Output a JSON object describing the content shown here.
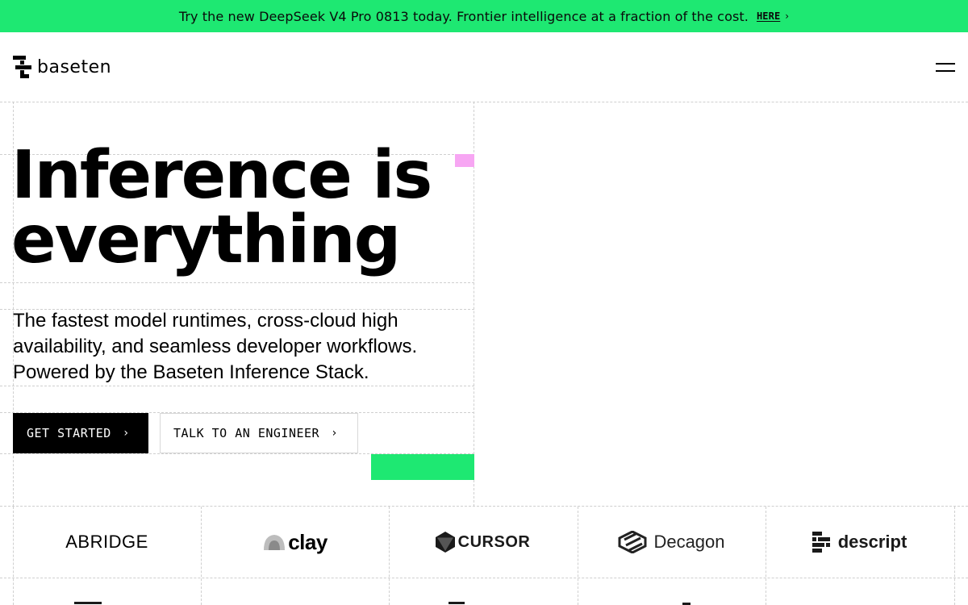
{
  "banner": {
    "text": "Try the new DeepSeek V4 Pro 0813 today. Frontier intelligence at a fraction of the cost.",
    "link_label": "HERE",
    "color": "#1ee872"
  },
  "header": {
    "brand": "baseten",
    "menu_icon": "hamburger-icon"
  },
  "hero": {
    "title_line1": "Inference is",
    "title_line2": "everything",
    "subtitle": "The fastest model runtimes, cross-cloud high availability, and seamless developer workflows. Powered by the Baseten Inference Stack.",
    "primary_cta": "GET STARTED",
    "secondary_cta": "TALK TO AN ENGINEER"
  },
  "customers": [
    {
      "name": "ABRIDGE",
      "icon": "abridge-logo"
    },
    {
      "name": "clay",
      "icon": "clay-logo"
    },
    {
      "name": "CURSOR",
      "icon": "cursor-logo"
    },
    {
      "name": "Decagon",
      "icon": "decagon-logo"
    },
    {
      "name": "descript",
      "icon": "descript-logo"
    }
  ],
  "accent_colors": {
    "green": "#1ee872",
    "pink": "#f7a6f3"
  }
}
